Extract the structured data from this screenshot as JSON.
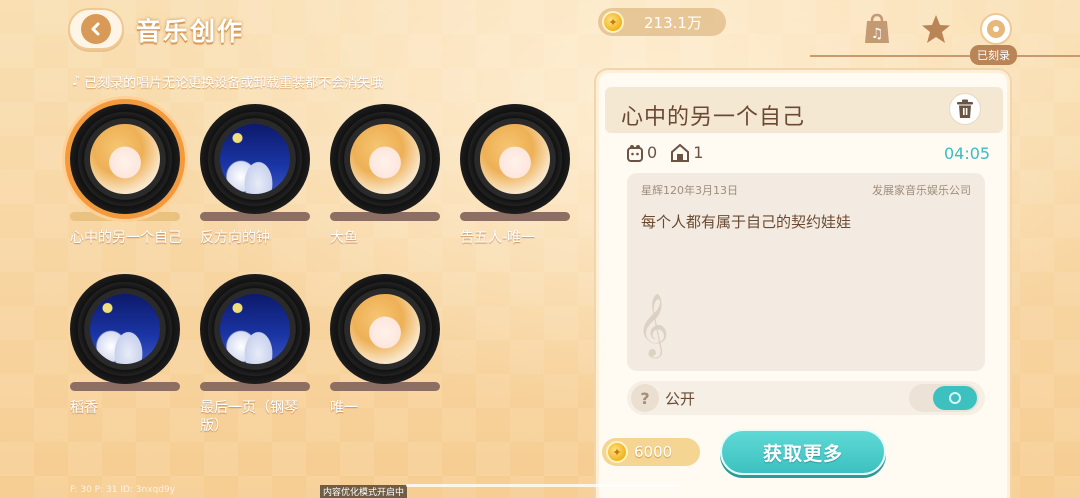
{
  "header": {
    "title": "音乐创作",
    "coins": "213.1万",
    "recorded_badge": "已刻录"
  },
  "notice": "已刻录的唱片无论更换设备或卸载重装都不会消失哦",
  "records": [
    {
      "name": "心中的另一个自己",
      "art": "girl",
      "selected": true
    },
    {
      "name": "反方向的钟",
      "art": "night",
      "selected": false
    },
    {
      "name": "大鱼",
      "art": "girl",
      "selected": false
    },
    {
      "name": "告五人-唯一",
      "art": "girl",
      "selected": false
    },
    {
      "name": "稻香",
      "art": "night",
      "selected": false
    },
    {
      "name": "最后一页（钢琴版）",
      "art": "night",
      "selected": false
    },
    {
      "name": "唯一",
      "art": "girl",
      "selected": false
    }
  ],
  "detail": {
    "title": "心中的另一个自己",
    "likes": "0",
    "plays": "1",
    "duration": "04:05",
    "date": "星辉120年3月13日",
    "company": "发展家音乐娱乐公司",
    "description": "每个人都有属于自己的契约娃娃",
    "public_label": "公开",
    "public_on": true,
    "price": "6000",
    "get_more": "获取更多"
  },
  "debug": {
    "left": "F: 30   P: 31   ID: 3nxqd9y",
    "mid": "内容优化模式开启中"
  }
}
